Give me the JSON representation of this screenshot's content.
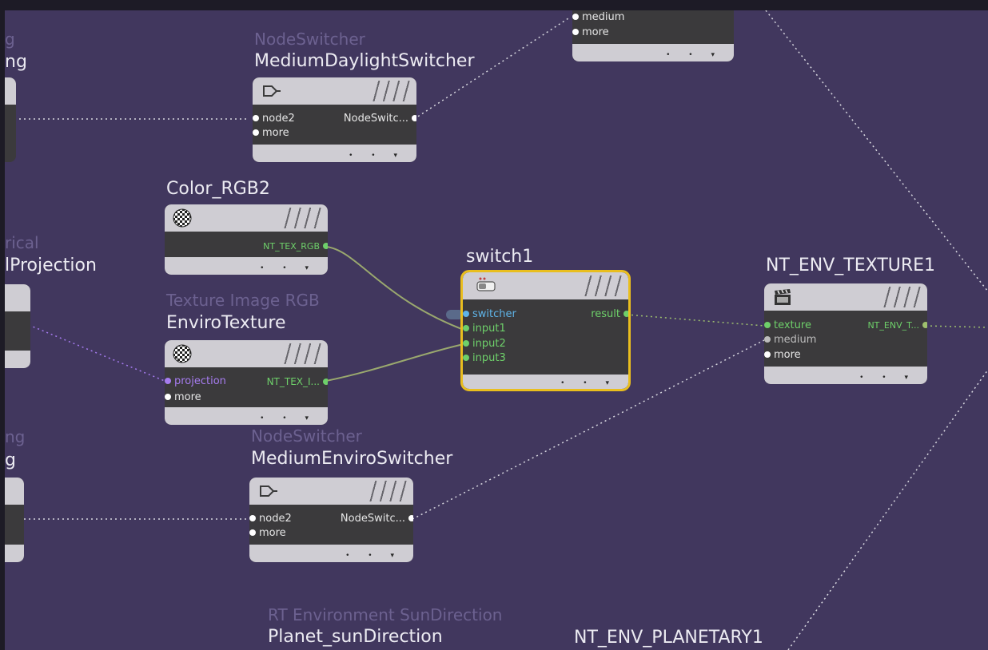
{
  "colors": {
    "canvas": "#41375e",
    "node_head": "#cfcdd3",
    "node_body": "#3b3a3c",
    "selection": "#e9be1e",
    "port_white": "#ffffff",
    "port_green": "#6ed06a",
    "port_blue": "#5fb4e8",
    "port_purple": "#a67cf0",
    "wire_white": "#d8d8e0",
    "wire_green": "#9aa86e",
    "wire_purple": "#a67cf0"
  },
  "nodes": {
    "left_top": {
      "type": "g",
      "name": "ng"
    },
    "left_mid": {
      "type": "rical",
      "name": "lProjection"
    },
    "left_bottom": {
      "type": "ng",
      "name": "g"
    },
    "top_partial": {
      "ports": [
        "medium",
        "more"
      ]
    },
    "medium_daylight_switcher": {
      "type": "NodeSwitcher",
      "name": "MediumDaylightSwitcher",
      "icon": "switch-plug-icon",
      "inputs": [
        "node2",
        "more"
      ],
      "output": "NodeSwitc..."
    },
    "color_rgb2": {
      "type": "",
      "name": "Color_RGB2",
      "icon": "checker-ball-icon",
      "output": "NT_TEX_RGB"
    },
    "enviro_texture": {
      "type": "Texture Image RGB",
      "name": "EnviroTexture",
      "icon": "checker-ball-icon",
      "inputs": [
        "projection",
        "more"
      ],
      "output": "NT_TEX_I..."
    },
    "switch1": {
      "name": "switch1",
      "icon": "switch-icon",
      "inputs": [
        "switcher",
        "input1",
        "input2",
        "input3"
      ],
      "output": "result"
    },
    "nt_env_texture1": {
      "name": "NT_ENV_TEXTURE1",
      "icon": "clapperboard-icon",
      "inputs": [
        "texture",
        "medium",
        "more"
      ],
      "output": "NT_ENV_T..."
    },
    "medium_enviro_switcher": {
      "type": "NodeSwitcher",
      "name": "MediumEnviroSwitcher",
      "icon": "switch-plug-icon",
      "inputs": [
        "node2",
        "more"
      ],
      "output": "NodeSwitc..."
    },
    "planet_sun_direction": {
      "type": "RT Environment SunDirection",
      "name": "Planet_sunDirection"
    },
    "nt_env_planetary1": {
      "name": "NT_ENV_PLANETARY1"
    },
    "footer_dots": "•  •  ▾"
  }
}
